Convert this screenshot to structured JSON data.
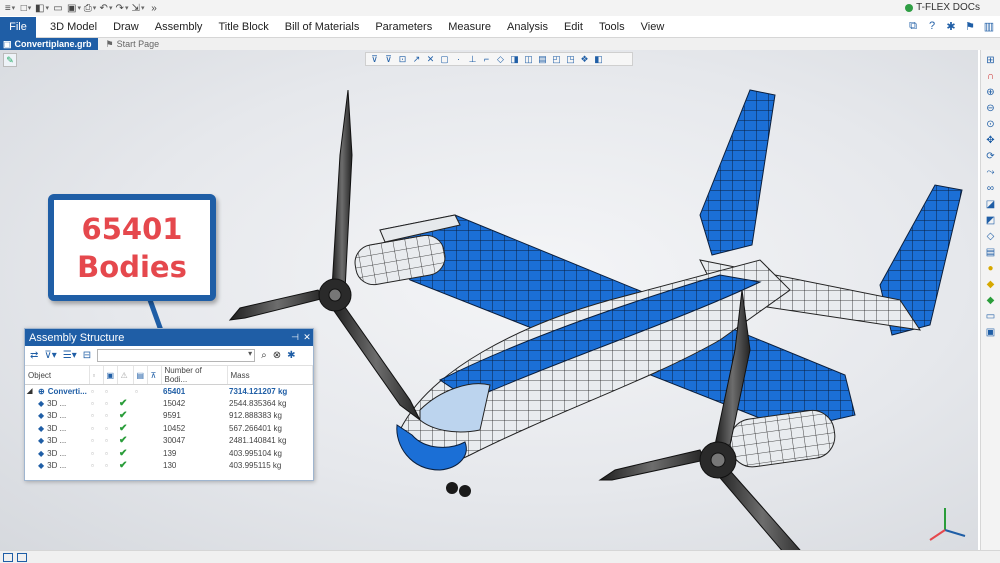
{
  "brand": {
    "name": "T-FLEX DOCs"
  },
  "menu": {
    "file": "File",
    "items": [
      "3D Model",
      "Draw",
      "Assembly",
      "Title Block",
      "Bill of Materials",
      "Parameters",
      "Measure",
      "Analysis",
      "Edit",
      "Tools",
      "View"
    ]
  },
  "tabs": {
    "active": "Convertiplane.grb",
    "start": "Start Page"
  },
  "callout": {
    "number": "65401",
    "label": "Bodies"
  },
  "panel": {
    "title": "Assembly Structure",
    "columns": [
      "Object",
      "Number of Bodi...",
      "Mass"
    ],
    "rows": [
      {
        "name": "Converti...",
        "bodies": "65401",
        "mass": "7314.121207 kg",
        "checked": false
      },
      {
        "name": "3D ...",
        "bodies": "15042",
        "mass": "2544.835364 kg",
        "checked": true
      },
      {
        "name": "3D ...",
        "bodies": "9591",
        "mass": "912.888383 kg",
        "checked": true
      },
      {
        "name": "3D ...",
        "bodies": "10452",
        "mass": "567.266401 kg",
        "checked": true
      },
      {
        "name": "3D ...",
        "bodies": "30047",
        "mass": "2481.140841 kg",
        "checked": true
      },
      {
        "name": "3D ...",
        "bodies": "139",
        "mass": "403.995104 kg",
        "checked": true
      },
      {
        "name": "3D ...",
        "bodies": "130",
        "mass": "403.995115 kg",
        "checked": true
      }
    ]
  },
  "colors": {
    "accent": "#1f5ea6",
    "callout_text": "#e5484d",
    "model_blue": "#1b6fd6"
  }
}
